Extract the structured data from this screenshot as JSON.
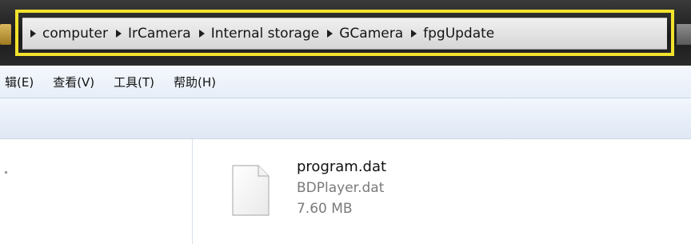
{
  "address_bar": {
    "breadcrumbs": [
      {
        "label": "computer"
      },
      {
        "label": "IrCamera"
      },
      {
        "label": "Internal storage"
      },
      {
        "label": "GCamera"
      },
      {
        "label": "fpgUpdate"
      }
    ],
    "highlight_color": "#f2e22c"
  },
  "menu": {
    "items": [
      {
        "label": "辑(E)"
      },
      {
        "label": "查看(V)"
      },
      {
        "label": "工具(T)"
      },
      {
        "label": "帮助(H)"
      }
    ]
  },
  "content": {
    "file": {
      "name": "program.dat",
      "subtitle": "BDPlayer.dat",
      "size": "7.60 MB",
      "icon": "document-icon"
    }
  }
}
